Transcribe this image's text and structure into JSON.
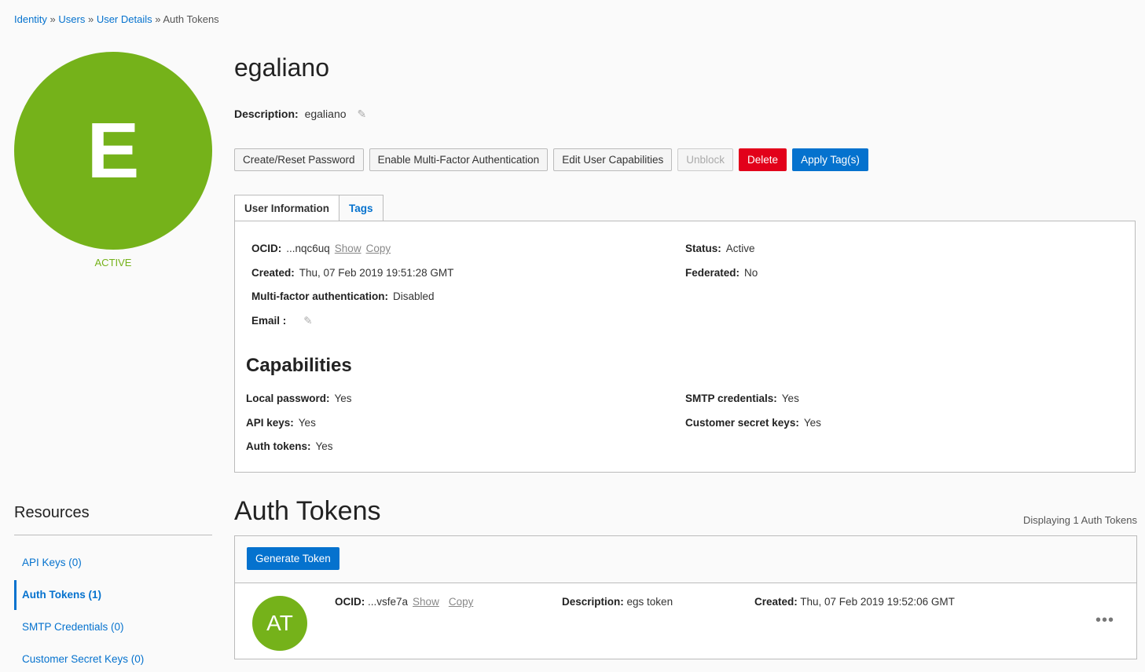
{
  "breadcrumb": [
    "Identity",
    "Users",
    "User Details",
    "Auth Tokens"
  ],
  "user": {
    "initial": "E",
    "status": "ACTIVE",
    "name": "egaliano",
    "description_label": "Description:",
    "description": "egaliano"
  },
  "buttons": {
    "reset": "Create/Reset Password",
    "mfa": "Enable Multi-Factor Authentication",
    "caps": "Edit User Capabilities",
    "unblock": "Unblock",
    "delete": "Delete",
    "tags": "Apply Tag(s)"
  },
  "tabs": [
    "User Information",
    "Tags"
  ],
  "info": {
    "ocid_label": "OCID:",
    "ocid": "...nqc6uq",
    "show": "Show",
    "copy": "Copy",
    "created_label": "Created:",
    "created": "Thu, 07 Feb 2019 19:51:28 GMT",
    "mfa_label": "Multi-factor authentication:",
    "mfa": "Disabled",
    "email_label": "Email :",
    "status_label": "Status:",
    "status": "Active",
    "fed_label": "Federated:",
    "fed": "No"
  },
  "capabilities": {
    "title": "Capabilities",
    "local_label": "Local password:",
    "local": "Yes",
    "api_label": "API keys:",
    "api": "Yes",
    "auth_label": "Auth tokens:",
    "auth": "Yes",
    "smtp_label": "SMTP credentials:",
    "smtp": "Yes",
    "csk_label": "Customer secret keys:",
    "csk": "Yes"
  },
  "resources": {
    "title": "Resources",
    "items": [
      "API Keys (0)",
      "Auth Tokens (1)",
      "SMTP Credentials (0)",
      "Customer Secret Keys (0)"
    ]
  },
  "tokens": {
    "title": "Auth Tokens",
    "displaying": "Displaying 1 Auth Tokens",
    "generate": "Generate Token",
    "item": {
      "initials": "AT",
      "ocid_label": "OCID:",
      "ocid": "...vsfe7a",
      "show": "Show",
      "copy": "Copy",
      "desc_label": "Description:",
      "desc": "egs token",
      "created_label": "Created:",
      "created": "Thu, 07 Feb 2019 19:52:06 GMT",
      "menu": "•••"
    }
  }
}
